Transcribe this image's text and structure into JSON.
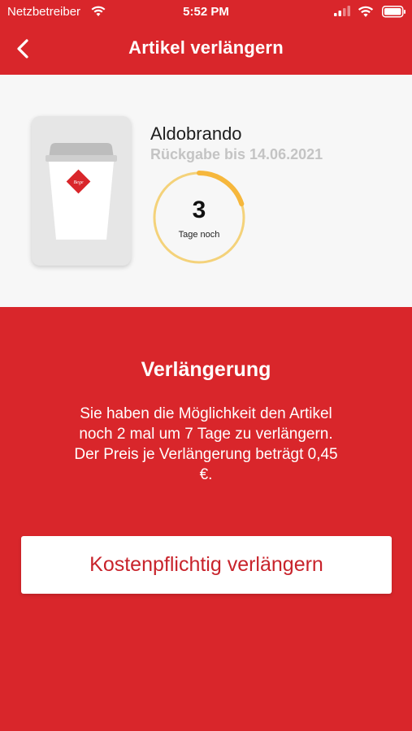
{
  "status_bar": {
    "carrier": "Netzbetreiber",
    "time": "5:52 PM",
    "icons": [
      "wifi-icon",
      "signal-icon",
      "battery-icon"
    ]
  },
  "nav": {
    "title": "Artikel verlängern",
    "back_icon": "chevron-left-icon"
  },
  "item": {
    "name": "Aldobrando",
    "return_label": "Rückgabe bis 14.06.2021",
    "days_left": "3",
    "days_label": "Tage noch",
    "ring_progress": 0.2,
    "image_icon": "coffee-cup-icon"
  },
  "extension": {
    "title": "Verlängerung",
    "lines": [
      "Sie haben die Möglichkeit den Artikel",
      "noch 2 mal um 7 Tage zu verlängern.",
      "Der Preis je Verlängerung beträgt 0,45",
      "€."
    ],
    "button_label": "Kostenpflichtig verlängern"
  },
  "colors": {
    "brand_red": "#d9262b",
    "ring_orange": "#f6b73c",
    "ring_track": "#f4d27a",
    "card_bg": "#f7f7f7"
  }
}
